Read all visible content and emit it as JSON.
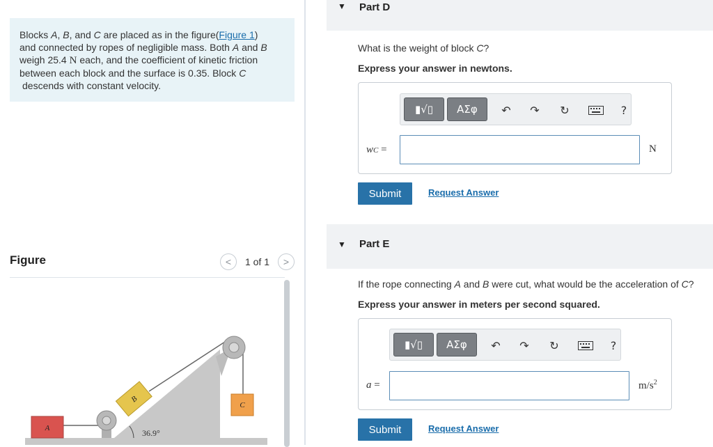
{
  "problem": {
    "intro": "Blocks ",
    "a": "A",
    "sep1": ", ",
    "b": "B",
    "sep2": ", and ",
    "c": "C",
    "mid": " are placed as in the figure(",
    "figure_link": "Figure 1",
    "close": ")",
    "line2a": "and connected by ropes of negligible mass. Both ",
    "line2b": " and ",
    "line3a": "weigh 25.4 ",
    "unit_n": "N",
    "line3b": " each, and the coefficient of kinetic friction",
    "line4a": "between each block and the surface is 0.35. Block ",
    "line5": "descends with constant velocity."
  },
  "figure": {
    "title": "Figure",
    "counter": "1 of 1",
    "prev": "<",
    "next": ">",
    "block_a": "A",
    "block_b": "B",
    "block_c": "C",
    "angle": "36.9°"
  },
  "parts": [
    {
      "title": "Part D",
      "question_a": "What is the weight of block ",
      "question_var": "C",
      "question_b": "?",
      "instruction": "Express your answer in newtons.",
      "var_label": "w",
      "var_sub": "C",
      "equals": " =",
      "unit": "N",
      "submit": "Submit",
      "request": "Request Answer"
    },
    {
      "title": "Part E",
      "question_a": "If the rope connecting ",
      "question_v1": "A",
      "question_mid": " and ",
      "question_v2": "B",
      "question_c": " were cut, what would be the acceleration of ",
      "question_v3": "C",
      "question_d": "?",
      "instruction": "Express your answer in meters per second squared.",
      "var_label": "a",
      "equals": " =",
      "unit": "m/s",
      "unit_exp": "2",
      "submit": "Submit",
      "request": "Request Answer"
    }
  ],
  "toolbar": {
    "templates": "▮√▯",
    "greek": "ΑΣφ",
    "help": "?"
  }
}
